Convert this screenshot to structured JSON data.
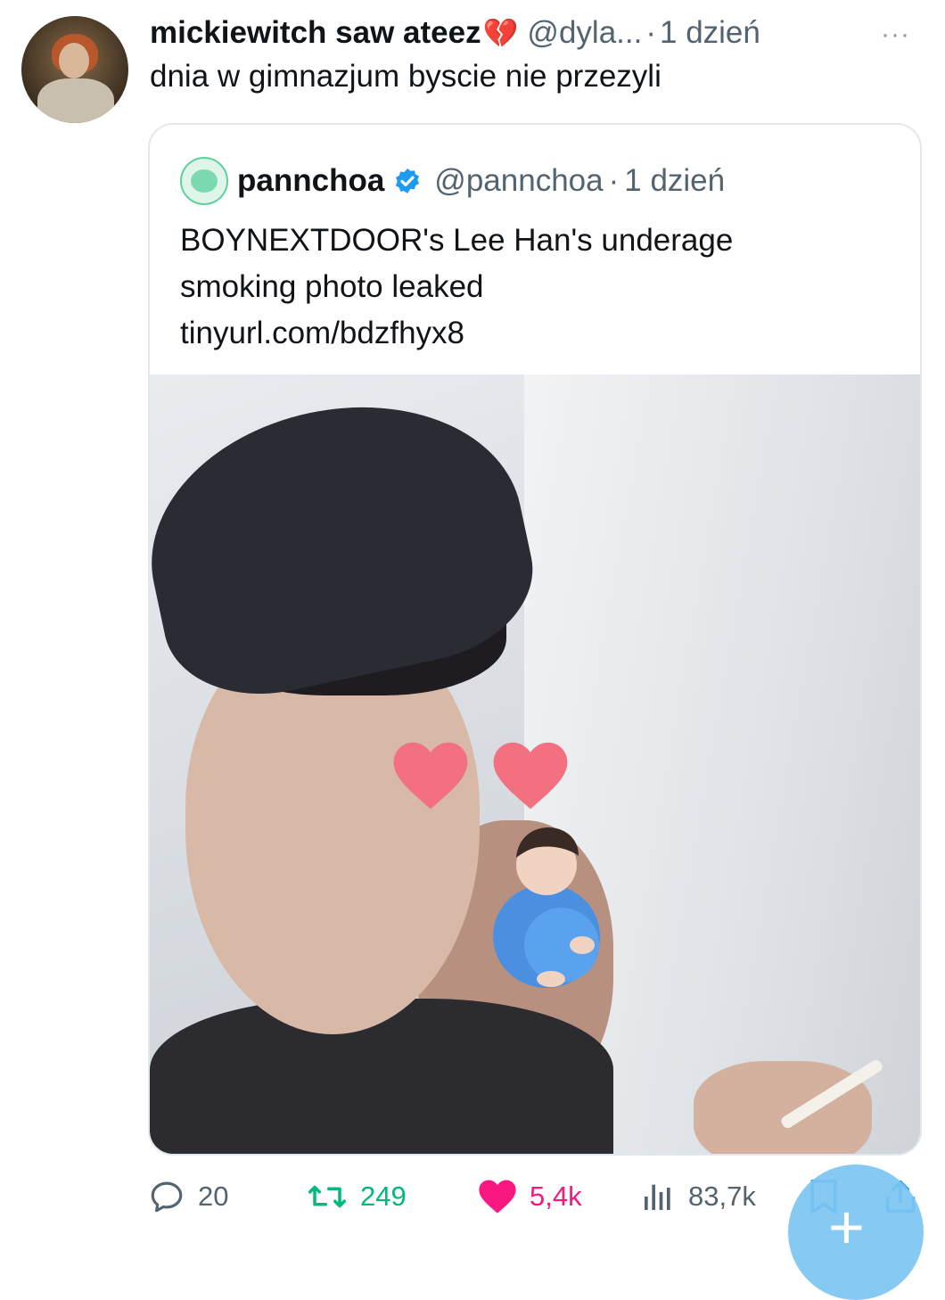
{
  "tweet": {
    "display_name": "mickiewitch saw ateez",
    "name_emoji": "💔",
    "handle": "@dyla...",
    "separator": "·",
    "time": "1 dzień",
    "more": "···",
    "text": "dnia w gimnazjum byscie nie przezyli"
  },
  "quote": {
    "display_name": "pannchoa",
    "handle": "@pannchoa",
    "separator": "·",
    "time": "1 dzień",
    "text_lines": [
      "BOYNEXTDOOR's Lee Han's underage",
      "smoking photo leaked",
      "tinyurl.com/bdzfhyx8"
    ]
  },
  "actions": {
    "replies": "20",
    "retweets": "249",
    "likes": "5,4k",
    "views": "83,7k"
  },
  "fab": {
    "label": "+"
  },
  "colors": {
    "retweet": "#00ba7c",
    "like": "#f91880",
    "verified": "#1d9bf0",
    "muted": "#536471",
    "fab": "#7cc5f3"
  }
}
